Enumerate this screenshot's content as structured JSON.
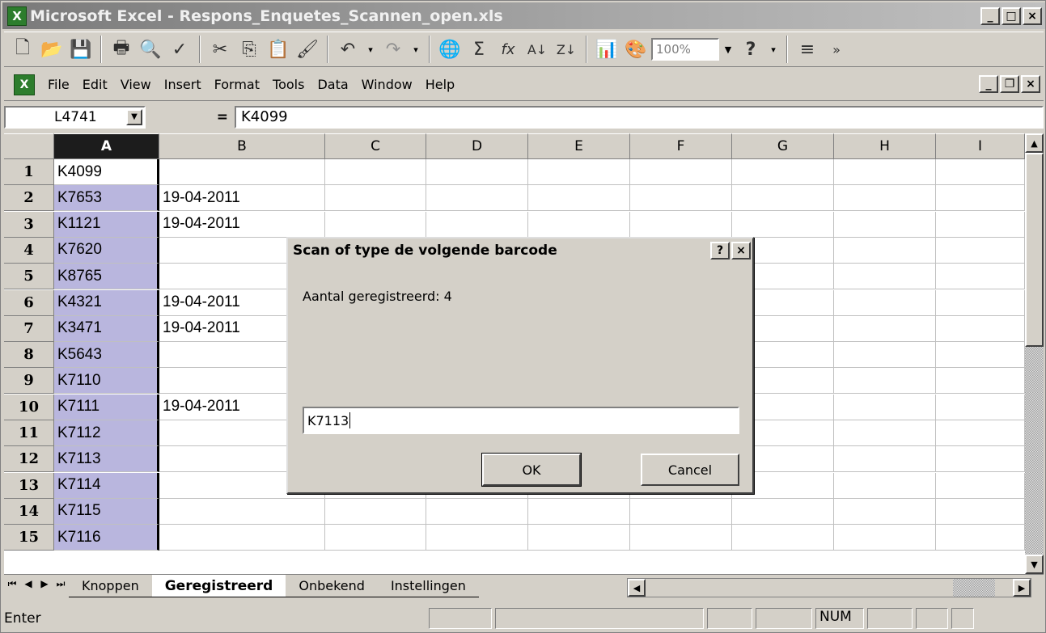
{
  "window": {
    "title": "Microsoft Excel - Respons_Enquetes_Scannen_open.xls",
    "minimize": "_",
    "maximize": "□",
    "close": "×"
  },
  "toolbar": {
    "icons": [
      "new-icon",
      "open-icon",
      "save-icon",
      "print-icon",
      "print-preview-icon",
      "spelling-icon",
      "cut-icon",
      "copy-icon",
      "paste-icon",
      "format-painter-icon",
      "undo-icon",
      "redo-icon",
      "hyperlink-icon",
      "autosum-icon",
      "function-icon",
      "sort-ascending-icon",
      "sort-descending-icon",
      "chart-wizard-icon",
      "drawing-icon"
    ],
    "zoom": "100%",
    "help_glyph": "?"
  },
  "menu": {
    "items": [
      "File",
      "Edit",
      "View",
      "Insert",
      "Format",
      "Tools",
      "Data",
      "Window",
      "Help"
    ],
    "underline": [
      "F",
      "E",
      "V",
      "I",
      "o",
      "T",
      "D",
      "W",
      "H"
    ]
  },
  "formula_bar": {
    "name_box": "L4741",
    "equals": "=",
    "value": "K4099"
  },
  "sheet": {
    "columns": [
      "A",
      "B",
      "C",
      "D",
      "E",
      "F",
      "G",
      "H",
      "I"
    ],
    "selected_column": "A",
    "rows": [
      {
        "n": "1",
        "a": "K4099",
        "b": ""
      },
      {
        "n": "2",
        "a": "K7653",
        "b": "19-04-2011"
      },
      {
        "n": "3",
        "a": "K1121",
        "b": "19-04-2011"
      },
      {
        "n": "4",
        "a": "K7620",
        "b": ""
      },
      {
        "n": "5",
        "a": "K8765",
        "b": ""
      },
      {
        "n": "6",
        "a": "K4321",
        "b": "19-04-2011"
      },
      {
        "n": "7",
        "a": "K3471",
        "b": "19-04-2011"
      },
      {
        "n": "8",
        "a": "K5643",
        "b": ""
      },
      {
        "n": "9",
        "a": "K7110",
        "b": ""
      },
      {
        "n": "10",
        "a": "K7111",
        "b": "19-04-2011"
      },
      {
        "n": "11",
        "a": "K7112",
        "b": ""
      },
      {
        "n": "12",
        "a": "K7113",
        "b": ""
      },
      {
        "n": "13",
        "a": "K7114",
        "b": ""
      },
      {
        "n": "14",
        "a": "K7115",
        "b": ""
      },
      {
        "n": "15",
        "a": "K7116",
        "b": ""
      }
    ]
  },
  "tabs": {
    "items": [
      "Knoppen",
      "Geregistreerd",
      "Onbekend",
      "Instellingen"
    ],
    "active": "Geregistreerd"
  },
  "status": {
    "mode": "Enter",
    "num": "NUM"
  },
  "dialog": {
    "title": "Scan of type de volgende barcode",
    "help": "?",
    "close": "×",
    "prompt": "Aantal geregistreerd: 4",
    "input_value": "K7113",
    "ok": "OK",
    "cancel": "Cancel"
  },
  "colors": {
    "selection": "#b9b6de",
    "chrome": "#d4d0c8"
  }
}
